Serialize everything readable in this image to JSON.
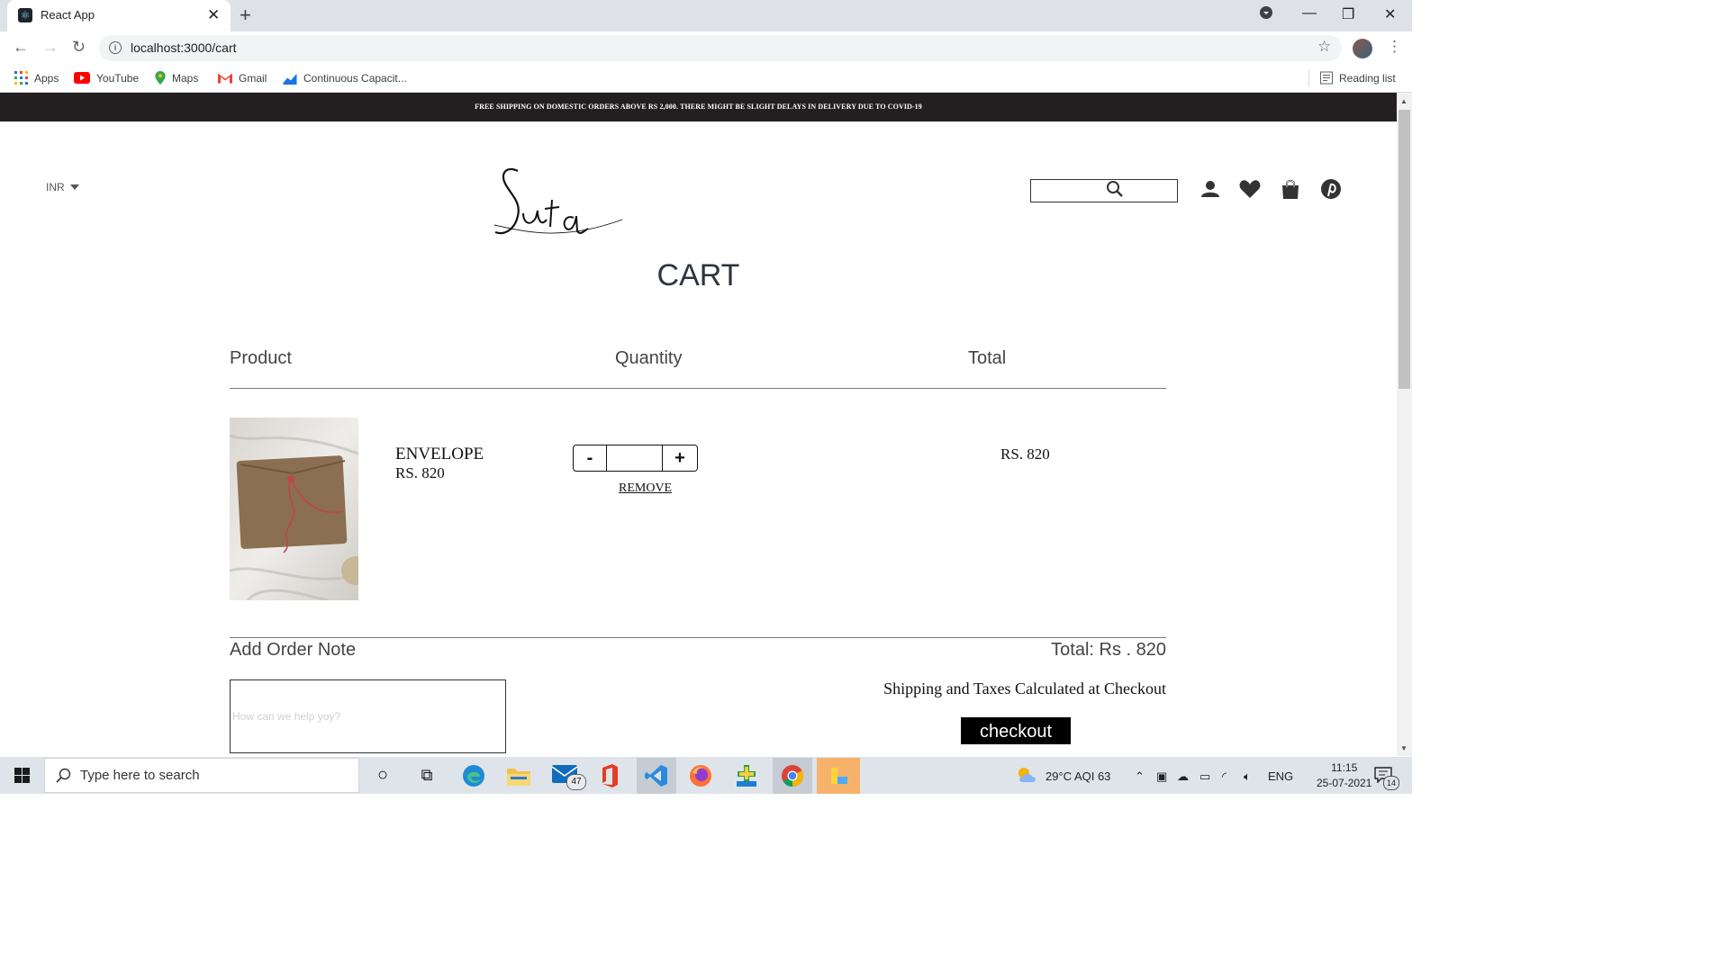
{
  "browser": {
    "tab_title": "React App",
    "url": "localhost:3000/cart",
    "bookmarks": [
      {
        "label": "Apps",
        "icon": "apps-grid-icon"
      },
      {
        "label": "YouTube",
        "icon": "youtube-icon"
      },
      {
        "label": "Maps",
        "icon": "maps-pin-icon"
      },
      {
        "label": "Gmail",
        "icon": "gmail-icon"
      },
      {
        "label": "Continuous Capacit...",
        "icon": "chart-bookmark-icon"
      }
    ],
    "reading_list": "Reading list"
  },
  "site": {
    "announcement": "FREE SHIPPING ON DOMESTIC ORDERS ABOVE RS 2,000. THERE MIGHT BE SLIGHT DELAYS IN DELIVERY DUE TO COVID-19",
    "currency": "INR",
    "logo_text": "Suta",
    "header_icons": [
      "search-icon",
      "user-icon",
      "heart-icon",
      "shopping-bag-icon",
      "pinterest-icon"
    ]
  },
  "cart": {
    "title": "CART",
    "columns": {
      "product": "Product",
      "quantity": "Quantity",
      "total": "Total"
    },
    "items": [
      {
        "name": "ENVELOPE",
        "price": "RS. 820",
        "quantity": "",
        "line_total": "RS. 820",
        "minus": "-",
        "plus": "+",
        "remove": "REMOVE"
      }
    ],
    "order_note_label": "Add Order Note",
    "order_note_placeholder": "How can we help yoy?",
    "grand_total": "Total: Rs . 820",
    "shipping_note": "Shipping and Taxes Calculated at Checkout",
    "checkout_label": "checkout"
  },
  "taskbar": {
    "search_placeholder": "Type here to search",
    "mail_badge": "47",
    "weather": "29°C  AQI 63",
    "language": "ENG",
    "time": "11:15",
    "date": "25-07-2021",
    "notification_count": "14"
  }
}
